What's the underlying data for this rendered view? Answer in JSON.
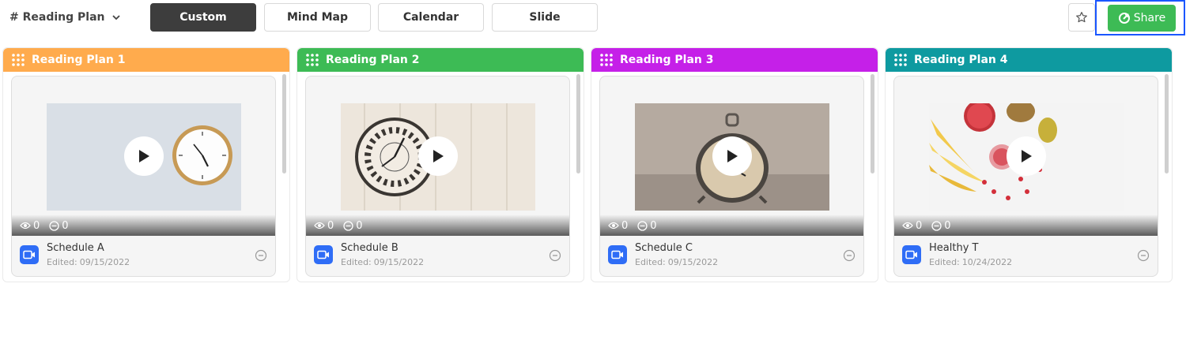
{
  "board": {
    "title": "# Reading Plan"
  },
  "views": [
    {
      "label": "Custom",
      "active": true
    },
    {
      "label": "Mind Map",
      "active": false
    },
    {
      "label": "Calendar",
      "active": false
    },
    {
      "label": "Slide",
      "active": false
    }
  ],
  "toolbar": {
    "share_label": "Share",
    "star_icon": "star-icon",
    "share_icon": "share-icon"
  },
  "colors": {
    "plan1": "#ffab4d",
    "plan2": "#3dbb55",
    "plan3": "#c520e8",
    "plan4": "#0e9aa0",
    "share": "#3dbb55",
    "video_icon": "#2f6df6"
  },
  "columns": [
    {
      "title": "Reading Plan 1",
      "card": {
        "title": "Schedule A",
        "edited_label": "Edited:",
        "edited_date": "09/15/2022",
        "views": "0",
        "comments": "0"
      }
    },
    {
      "title": "Reading Plan 2",
      "card": {
        "title": "Schedule B",
        "edited_label": "Edited:",
        "edited_date": "09/15/2022",
        "views": "0",
        "comments": "0"
      }
    },
    {
      "title": "Reading Plan 3",
      "card": {
        "title": "Schedule C",
        "edited_label": "Edited:",
        "edited_date": "09/15/2022",
        "views": "0",
        "comments": "0"
      }
    },
    {
      "title": "Reading Plan 4",
      "card": {
        "title": "Healthy T",
        "edited_label": "Edited:",
        "edited_date": "10/24/2022",
        "views": "0",
        "comments": "0"
      }
    }
  ]
}
